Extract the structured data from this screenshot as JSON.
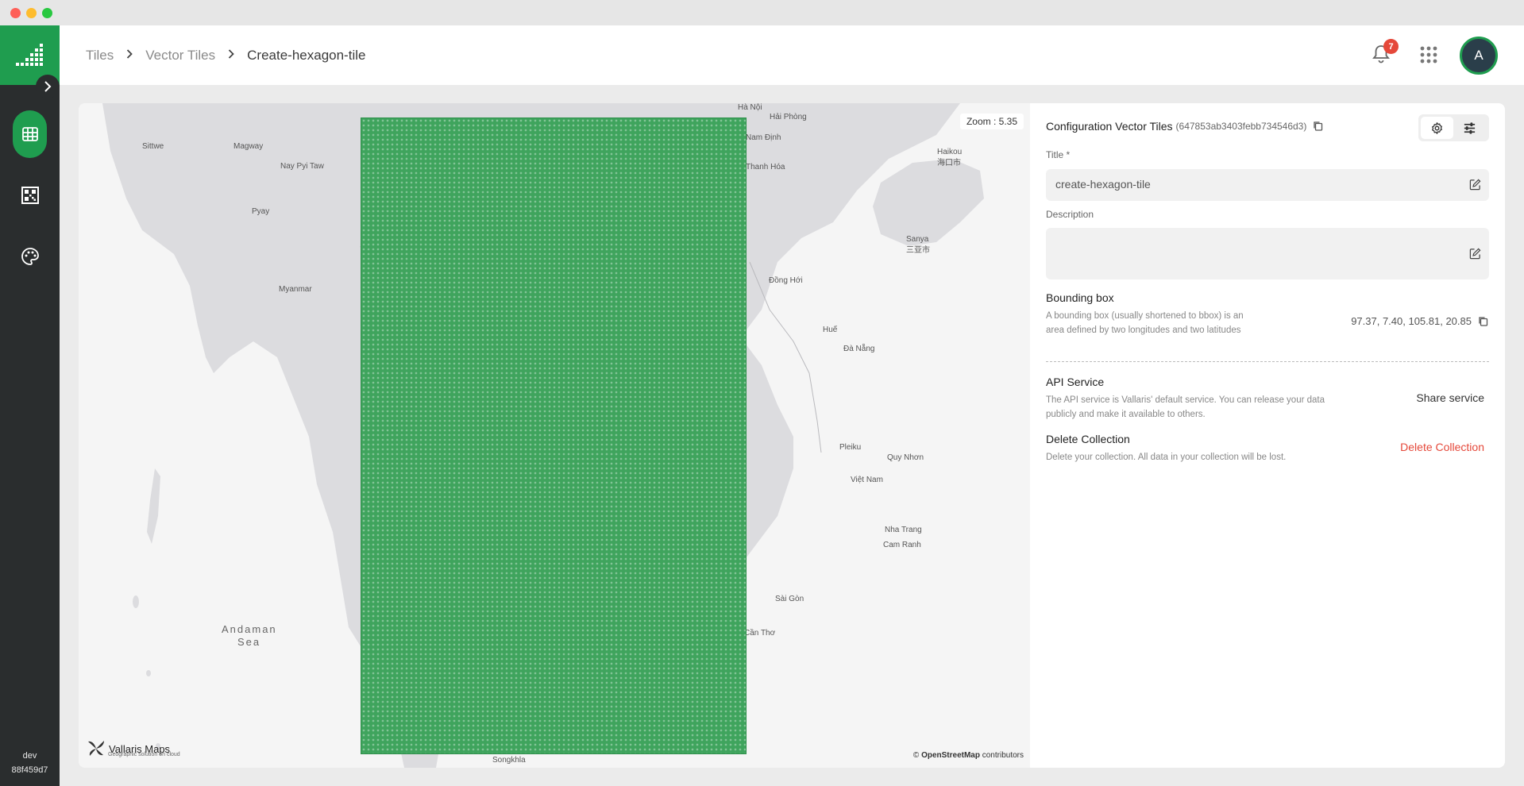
{
  "header": {
    "breadcrumb": [
      "Tiles",
      "Vector Tiles",
      "Create-hexagon-tile"
    ],
    "notification_count": "7",
    "avatar_initial": "A"
  },
  "sidebar": {
    "env_name": "dev",
    "env_hash": "88f459d7",
    "items": [
      {
        "icon": "table-grid-icon",
        "active": true
      },
      {
        "icon": "qr-grid-icon",
        "active": false
      },
      {
        "icon": "palette-icon",
        "active": false
      }
    ]
  },
  "map": {
    "zoom_label": "Zoom : 5.35",
    "labels": [
      "Hà Nội",
      "Hải Phòng",
      "Nam Định",
      "Thanh Hóa",
      "Sittwe",
      "Magway",
      "Nay Pyi Taw",
      "Pyay",
      "Myanmar",
      "Haikou",
      "海口市",
      "Sanya",
      "三亚市",
      "Đồng Hới",
      "Huế",
      "Đà Nẵng",
      "Pleiku",
      "Quy Nhơn",
      "Việt Nam",
      "Nha Trang",
      "Cam Ranh",
      "Sài Gòn",
      "Cần Thơ",
      "Andaman",
      "Sea",
      "Songkhla"
    ],
    "brand_name": "Vallaris Maps",
    "brand_tagline": "Geographic solution on cloud",
    "attribution_prefix": "©",
    "attribution_link": "OpenStreetMap",
    "attribution_suffix": "contributors"
  },
  "panel": {
    "title": "Configuration Vector Tiles",
    "collection_id": "(647853ab3403febb734546d3)",
    "title_label": "Title *",
    "title_value": "create-hexagon-tile",
    "description_label": "Description",
    "description_value": "",
    "bbox_title": "Bounding box",
    "bbox_desc": "A bounding box (usually shortened to bbox) is an area defined by two longitudes and two latitudes",
    "bbox_value": "97.37, 7.40, 105.81, 20.85",
    "api_title": "API Service",
    "api_desc": "The API service is Vallaris' default service. You can release your data publicly and make it available to others.",
    "share_label": "Share service",
    "delete_title": "Delete Collection",
    "delete_desc": "Delete your collection. All data in your collection will be lost.",
    "delete_label": "Delete Collection"
  },
  "colors": {
    "brand_green": "#1f9d4f",
    "sidebar_bg": "#2a2d2e",
    "danger": "#e5483a",
    "hex_fill": "#3fa45d"
  }
}
